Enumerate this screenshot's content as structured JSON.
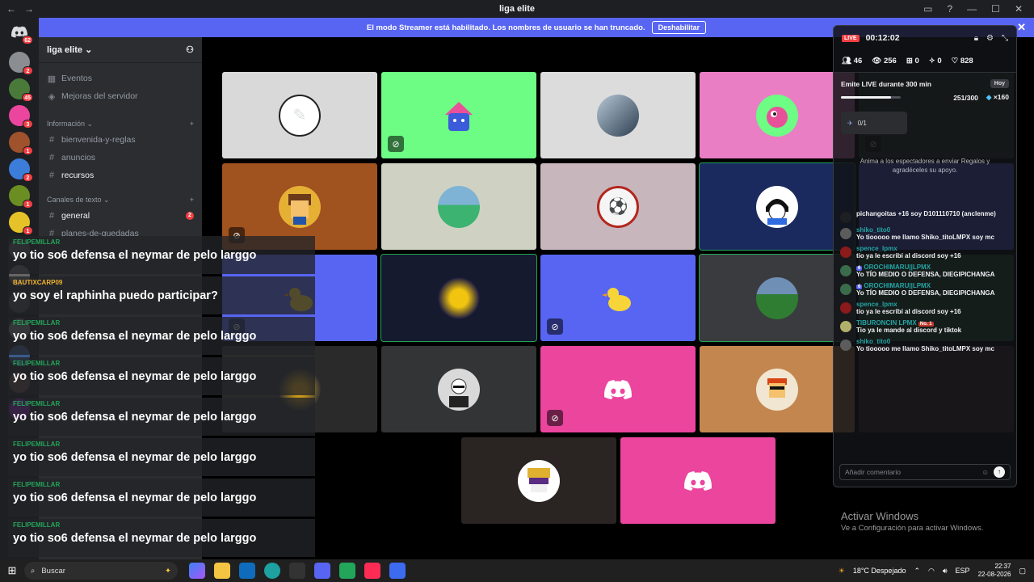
{
  "window": {
    "title": "liga elite"
  },
  "banner": {
    "text": "El modo Streamer está habilitado. Los nombres de usuario se han truncado.",
    "button": "Deshabilitar"
  },
  "rail": {
    "home_badge": "62",
    "badges": [
      "2",
      "45",
      "3",
      "1",
      "2",
      "1",
      "1"
    ]
  },
  "sidebar": {
    "server_name": "liga elite",
    "items": [
      {
        "label": "Eventos"
      },
      {
        "label": "Mejoras del servidor"
      }
    ],
    "category_info": "Información",
    "info_channels": [
      "bienvenida-y-reglas",
      "anuncios",
      "recursos"
    ],
    "category_text": "Canales de texto",
    "text_channels": [
      {
        "label": "general",
        "badge": "2"
      },
      {
        "label": "planes-de-quedadas"
      }
    ]
  },
  "live": {
    "badge": "LIVE",
    "timer": "00:12:02",
    "stats": {
      "viewers_people": "46",
      "views": "256",
      "gifts": "0",
      "shares": "0",
      "likes": "828"
    },
    "mission": {
      "title": "Emite LIVE durante 300 min",
      "tag": "Hoy",
      "progress_text": "251/300",
      "progress": 0.837,
      "reward": "×160"
    },
    "goal": "0/1",
    "hint": "Anima a los espectadores a enviar Regalos y agradéceles su apoyo.",
    "comment_placeholder": "Añadir comentario",
    "messages": [
      {
        "name": "",
        "text": "pichangoitas +16 soy D101110710 (anclenme)",
        "color": "#1e1f22"
      },
      {
        "name": "shiko_tito0",
        "text": "Yo tiooooo me llamo Shiko_titoLMPX soy mc",
        "color": "#5c5c5c"
      },
      {
        "name": "spence_lpmx",
        "text": "tio ya le escribí al discord soy +16",
        "color": "#8b1a1a"
      },
      {
        "name": "OROCHIMARU||LPMX",
        "level": "6",
        "text": "Yo TÍO MEDIO O DEFENSA, DIEGIPICHANGA",
        "color": "#3a6b4a"
      },
      {
        "name": "OROCHIMARU||LPMX",
        "level": "6",
        "text": "Yo TÍO MEDIO O DEFENSA, DIEGIPICHANGA",
        "color": "#3a6b4a"
      },
      {
        "name": "spence_lpmx",
        "text": "tio ya le escribí al discord soy +16",
        "color": "#8b1a1a"
      },
      {
        "name": "TIBURONCIN LPMX",
        "badge": "No. 1",
        "text": "Tio ya le mande al discord y tiktok",
        "color": "#b0b06a"
      },
      {
        "name": "shiko_tito0",
        "text": "Yo tiooooo me llamo Shiko_titoLMPX soy mc",
        "color": "#5c5c5c"
      }
    ]
  },
  "overlay": [
    {
      "user": "FELIPEMILLAR",
      "text": "yo tio so6 defensa el neymar de pelo larggo"
    },
    {
      "user": "BAUTIXCARP09",
      "text": "yo soy el raphinha puedo participar?"
    },
    {
      "user": "FELIPEMILLAR",
      "text": "yo tio so6 defensa el neymar de pelo larggo"
    },
    {
      "user": "FELIPEMILLAR",
      "text": "yo tio so6 defensa el neymar de pelo larggo"
    },
    {
      "user": "FELIPEMILLAR",
      "text": "yo tio so6 defensa el neymar de pelo larggo"
    },
    {
      "user": "FELIPEMILLAR",
      "text": "yo tio so6 defensa el neymar de pelo larggo"
    },
    {
      "user": "FELIPEMILLAR",
      "text": "yo tio so6 defensa el neymar de pelo larggo"
    },
    {
      "user": "FELIPEMILLAR",
      "text": "yo tio so6 defensa el neymar de pelo larggo"
    }
  ],
  "watermark": {
    "line1": "Activar Windows",
    "line2": "Ve a Configuración para activar Windows."
  },
  "taskbar": {
    "search": "Buscar",
    "weather": "18°C  Despejado",
    "lang": "ESP",
    "time": "22:37",
    "date": "22-08-2026"
  }
}
